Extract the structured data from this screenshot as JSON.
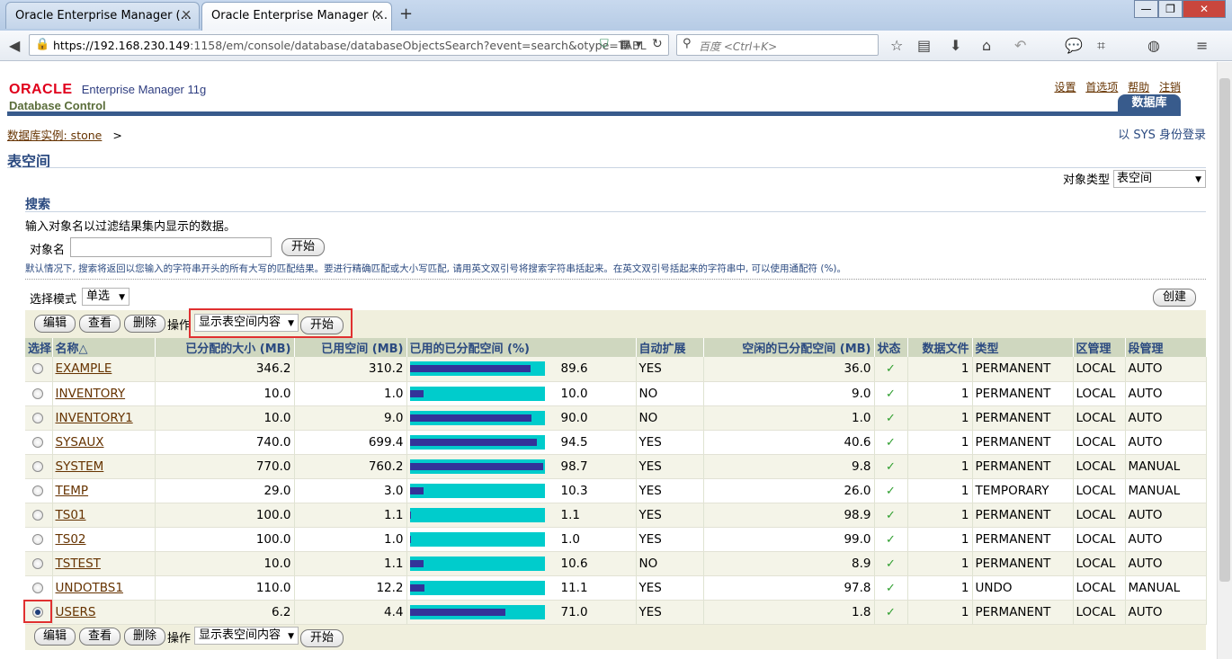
{
  "browser": {
    "tabs": [
      {
        "title": "Oracle Enterprise Manager (...",
        "close": "✕"
      },
      {
        "title": "Oracle Enterprise Manager (...",
        "close": "✕"
      }
    ],
    "new_tab": "+",
    "url_host": "https://192.168.230.149",
    "url_rest": ":1158/em/console/database/databaseObjectsSearch?event=search&otype=TABL",
    "search_placeholder": "百度 <Ctrl+K>"
  },
  "header": {
    "oracle": "ORACLE",
    "product": "Enterprise Manager 11g",
    "subproduct": "Database Control",
    "links": [
      "设置",
      "首选项",
      "帮助",
      "注销"
    ],
    "db_tab": "数据库"
  },
  "breadcrumb": {
    "link": "数据库实例: stone",
    "sep": ">"
  },
  "login_as": "以 SYS 身份登录",
  "page_title": "表空间",
  "object_type": {
    "label": "对象类型",
    "value": "表空间"
  },
  "search": {
    "heading": "搜索",
    "description": "输入对象名以过滤结果集内显示的数据。",
    "object_name_label": "对象名",
    "object_name_value": "",
    "go_label": "开始",
    "hint": "默认情况下, 搜索将返回以您输入的字符串开头的所有大写的匹配结果。要进行精确匹配或大小写匹配, 请用英文双引号将搜索字符串括起来。在英文双引号括起来的字符串中, 可以使用通配符 (%)。"
  },
  "selection_mode": {
    "label": "选择模式",
    "value": "单选"
  },
  "create_label": "创建",
  "toolbar": {
    "edit": "编辑",
    "view": "查看",
    "delete": "删除",
    "actions_label": "操作",
    "actions_value": "显示表空间内容",
    "go": "开始"
  },
  "columns": [
    "选择",
    "名称△",
    "已分配的大小 (MB)",
    "已用空间 (MB)",
    "已用的已分配空间 (%)",
    "自动扩展",
    "空闲的已分配空间 (MB)",
    "状态",
    "数据文件",
    "类型",
    "区管理",
    "段管理"
  ],
  "rows": [
    {
      "selected": false,
      "name": "EXAMPLE",
      "allocated": "346.2",
      "used": "310.2",
      "pct": 89.6,
      "pct_text": "89.6",
      "autoext": "YES",
      "free": "36.0",
      "status": "✓",
      "files": "1",
      "type": "PERMANENT",
      "extent": "LOCAL",
      "segment": "AUTO"
    },
    {
      "selected": false,
      "name": "INVENTORY",
      "allocated": "10.0",
      "used": "1.0",
      "pct": 10.0,
      "pct_text": "10.0",
      "autoext": "NO",
      "free": "9.0",
      "status": "✓",
      "files": "1",
      "type": "PERMANENT",
      "extent": "LOCAL",
      "segment": "AUTO"
    },
    {
      "selected": false,
      "name": "INVENTORY1",
      "allocated": "10.0",
      "used": "9.0",
      "pct": 90.0,
      "pct_text": "90.0",
      "autoext": "NO",
      "free": "1.0",
      "status": "✓",
      "files": "1",
      "type": "PERMANENT",
      "extent": "LOCAL",
      "segment": "AUTO"
    },
    {
      "selected": false,
      "name": "SYSAUX",
      "allocated": "740.0",
      "used": "699.4",
      "pct": 94.5,
      "pct_text": "94.5",
      "autoext": "YES",
      "free": "40.6",
      "status": "✓",
      "files": "1",
      "type": "PERMANENT",
      "extent": "LOCAL",
      "segment": "AUTO"
    },
    {
      "selected": false,
      "name": "SYSTEM",
      "allocated": "770.0",
      "used": "760.2",
      "pct": 98.7,
      "pct_text": "98.7",
      "autoext": "YES",
      "free": "9.8",
      "status": "✓",
      "files": "1",
      "type": "PERMANENT",
      "extent": "LOCAL",
      "segment": "MANUAL"
    },
    {
      "selected": false,
      "name": "TEMP",
      "allocated": "29.0",
      "used": "3.0",
      "pct": 10.3,
      "pct_text": "10.3",
      "autoext": "YES",
      "free": "26.0",
      "status": "✓",
      "files": "1",
      "type": "TEMPORARY",
      "extent": "LOCAL",
      "segment": "MANUAL"
    },
    {
      "selected": false,
      "name": "TS01",
      "allocated": "100.0",
      "used": "1.1",
      "pct": 1.1,
      "pct_text": "1.1",
      "autoext": "YES",
      "free": "98.9",
      "status": "✓",
      "files": "1",
      "type": "PERMANENT",
      "extent": "LOCAL",
      "segment": "AUTO"
    },
    {
      "selected": false,
      "name": "TS02",
      "allocated": "100.0",
      "used": "1.0",
      "pct": 1.0,
      "pct_text": "1.0",
      "autoext": "YES",
      "free": "99.0",
      "status": "✓",
      "files": "1",
      "type": "PERMANENT",
      "extent": "LOCAL",
      "segment": "AUTO"
    },
    {
      "selected": false,
      "name": "TSTEST",
      "allocated": "10.0",
      "used": "1.1",
      "pct": 10.6,
      "pct_text": "10.6",
      "autoext": "NO",
      "free": "8.9",
      "status": "✓",
      "files": "1",
      "type": "PERMANENT",
      "extent": "LOCAL",
      "segment": "AUTO"
    },
    {
      "selected": false,
      "name": "UNDOTBS1",
      "allocated": "110.0",
      "used": "12.2",
      "pct": 11.1,
      "pct_text": "11.1",
      "autoext": "YES",
      "free": "97.8",
      "status": "✓",
      "files": "1",
      "type": "UNDO",
      "extent": "LOCAL",
      "segment": "MANUAL"
    },
    {
      "selected": true,
      "name": "USERS",
      "allocated": "6.2",
      "used": "4.4",
      "pct": 71.0,
      "pct_text": "71.0",
      "autoext": "YES",
      "free": "1.8",
      "status": "✓",
      "files": "1",
      "type": "PERMANENT",
      "extent": "LOCAL",
      "segment": "AUTO"
    }
  ],
  "colors": {
    "bar_bg": "#00cccc",
    "bar_fill": "#333399",
    "header_blue": "#385b8c",
    "link": "#663300"
  }
}
